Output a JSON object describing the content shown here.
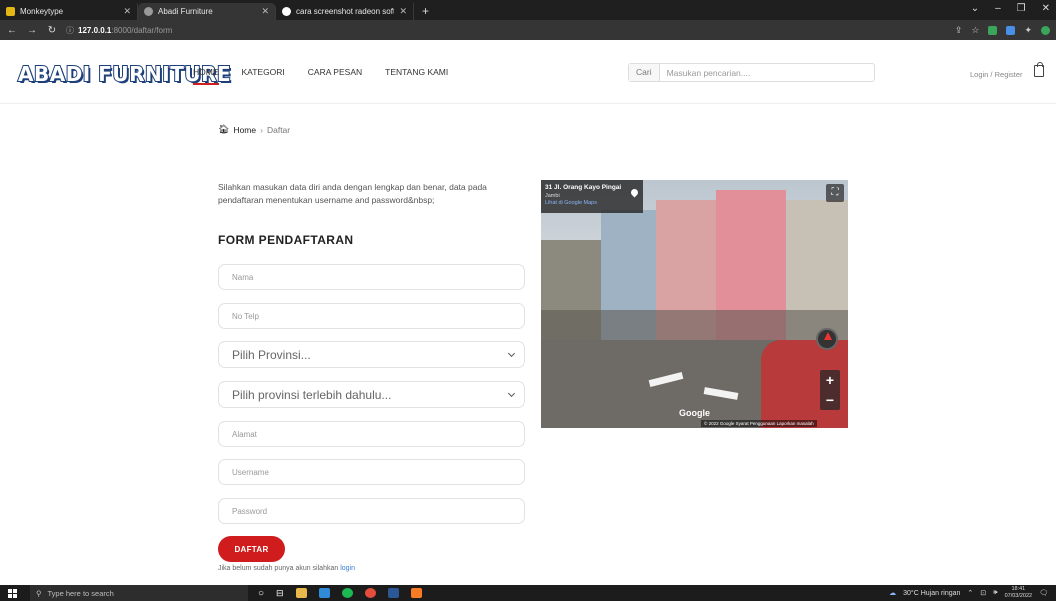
{
  "browser": {
    "tabs": [
      {
        "title": "Monkeytype",
        "favicon_color": "#e2b714",
        "active": false
      },
      {
        "title": "Abadi Furniture",
        "favicon_color": "#9a9a9a",
        "active": true
      },
      {
        "title": "cara screenshot radeon softwar",
        "favicon_color": "#ffffff",
        "active": false
      }
    ],
    "new_tab": "+",
    "url_host": "127.0.0.1",
    "url_rest": ":8000/daftar/form"
  },
  "header": {
    "logo": "ABADI FURNITURE",
    "menu": [
      {
        "label": "HOME",
        "active": true
      },
      {
        "label": "KATEGORI",
        "active": false
      },
      {
        "label": "CARA PESAN",
        "active": false
      },
      {
        "label": "TENTANG KAMI",
        "active": false
      }
    ],
    "search_label": "Cari",
    "search_placeholder": "Masukan pencarian....",
    "login": "Login / Register"
  },
  "breadcrumb": {
    "home": "Home",
    "separator": "›",
    "current": "Daftar"
  },
  "form": {
    "intro": "Silahkan masukan data diri anda dengan lengkap dan benar, data pada pendaftaran menentukan username and password&nbsp;",
    "title": "FORM PENDAFTARAN",
    "fields": {
      "nama": "Nama",
      "telp": "No Telp",
      "alamat": "Alamat",
      "username": "Username",
      "password": "Password"
    },
    "provinsi": "Pilih Provinsi...",
    "kota": "Pilih provinsi terlebih dahulu...",
    "submit": "DAFTAR",
    "note": "Jika belum sudah punya akun silahkan",
    "note_link": "login"
  },
  "streetview": {
    "address": "31 Jl. Orang Kayo Pingai",
    "city": "Jambi",
    "link": "Lihat di Google Maps",
    "brand": "Google",
    "footer": "© 2022 Google   Syarat Penggunaan   Laporkan masalah"
  },
  "taskbar": {
    "search_placeholder": "Type here to search",
    "weather": "30°C  Hujan ringan",
    "time": "18:41",
    "date": "07/03/2022"
  }
}
